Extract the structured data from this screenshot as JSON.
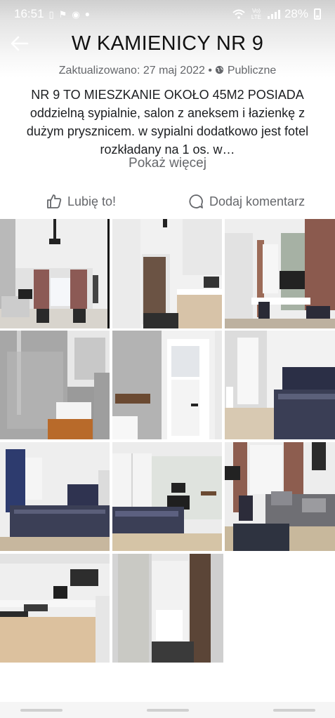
{
  "status_bar": {
    "time": "16:51",
    "battery": "28%",
    "network": "Vo) LTE",
    "icons": [
      "m-icon",
      "flag-icon",
      "chrome-icon",
      "dot-icon",
      "wifi-icon",
      "signal-icon",
      "battery-icon"
    ]
  },
  "album": {
    "title": "W KAMIENICY NR 9",
    "updated": "Zaktualizowano: 27 maj 2022",
    "separator": "•",
    "privacy": "Publiczne",
    "description": "NR 9 TO MIESZKANIE OKOŁO 45M2 POSIADA oddzielną sypialnie, salon z aneksem i łazienkę z dużym prysznicem. w sypialni dodatkowo jest fotel rozkładany na 1 os. w…",
    "see_more": "Pokaż więcej"
  },
  "actions": {
    "like_label": "Lubię to!",
    "comment_label": "Dodaj komentarz"
  },
  "photos": [
    "living-room-photo",
    "kitchen-entrance-photo",
    "living-room-desk-photo",
    "bathroom-shower-photo",
    "bathroom-door-photo",
    "bedroom-photo",
    "bedroom-window-photo",
    "bedroom-wardrobe-photo",
    "living-room-sofa-photo",
    "kitchenette-photo",
    "hallway-door-photo"
  ],
  "colors": {
    "text_primary": "#1c1e21",
    "text_secondary": "#65676b",
    "header_gradient_top": "#cfcfcf"
  }
}
